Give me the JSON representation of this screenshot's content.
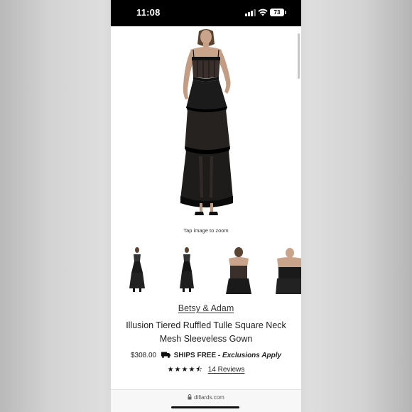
{
  "status_bar": {
    "time": "11:08",
    "battery": "73"
  },
  "product": {
    "zoom_hint": "Tap image to zoom",
    "brand": "Betsy & Adam",
    "title": "Illusion Tiered Ruffled Tulle Square Neck Mesh Sleeveless Gown",
    "price": "$308.00",
    "shipping_label": "SHIPS FREE -",
    "shipping_note": "Exclusions Apply",
    "rating_stars": "★★★★⯪",
    "reviews": "14 Reviews"
  },
  "browser": {
    "url": "dillards.com"
  },
  "icons": {
    "signal": "signal-icon",
    "wifi": "wifi-icon",
    "battery": "battery-icon",
    "truck": "truck-icon",
    "lock": "lock-icon"
  },
  "colors": {
    "status_bar": "#000000",
    "text": "#222222",
    "page": "#ffffff"
  }
}
